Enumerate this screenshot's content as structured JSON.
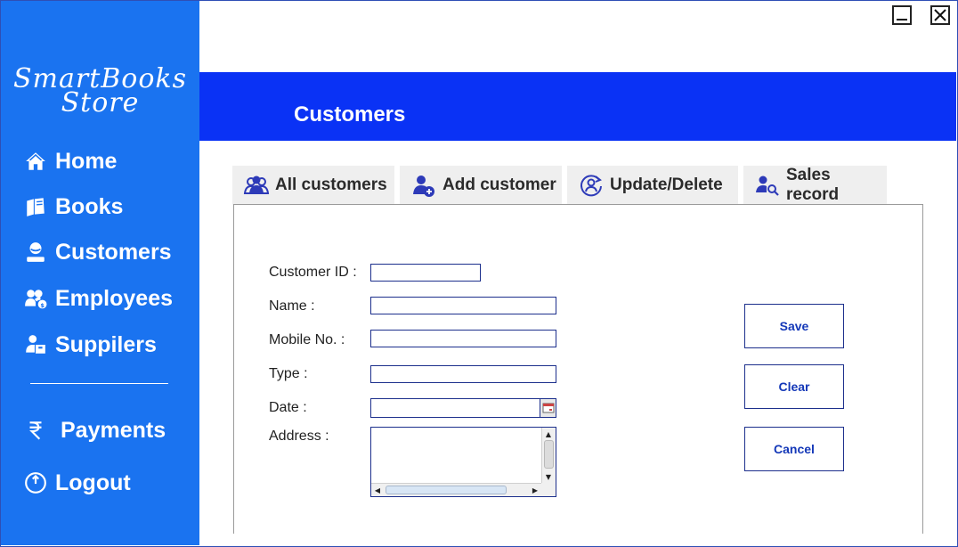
{
  "app": {
    "logo_line1": "SmartBooks",
    "logo_line2": "Store"
  },
  "sidebar": {
    "items": [
      {
        "label": "Home",
        "icon": "home-icon"
      },
      {
        "label": "Books",
        "icon": "books-icon"
      },
      {
        "label": "Customers",
        "icon": "customer-icon"
      },
      {
        "label": "Employees",
        "icon": "employees-icon"
      },
      {
        "label": "Suppilers",
        "icon": "suppliers-icon"
      },
      {
        "label": "Payments",
        "icon": "rupee-icon"
      },
      {
        "label": "Logout",
        "icon": "power-icon"
      }
    ]
  },
  "header": {
    "title": "Customers"
  },
  "tabs": [
    {
      "label": "All customers",
      "icon": "users-icon"
    },
    {
      "label": "Add customer",
      "icon": "add-user-icon"
    },
    {
      "label": "Update/Delete",
      "icon": "refresh-user-icon"
    },
    {
      "label": "Sales record",
      "icon": "search-user-icon"
    }
  ],
  "form": {
    "customer_id_label": "Customer ID :",
    "customer_id_value": "",
    "name_label": "Name :",
    "name_value": "",
    "mobile_label": "Mobile No. :",
    "mobile_value": "",
    "type_label": "Type :",
    "type_value": "",
    "date_label": "Date :",
    "date_value": "",
    "address_label": "Address :",
    "address_value": ""
  },
  "actions": {
    "save_label": "Save",
    "clear_label": "Clear",
    "cancel_label": "Cancel"
  },
  "colors": {
    "sidebar": "#1a73f0",
    "header": "#0a32f5",
    "button_text": "#1438b8",
    "field_border": "#1c2f8c"
  }
}
